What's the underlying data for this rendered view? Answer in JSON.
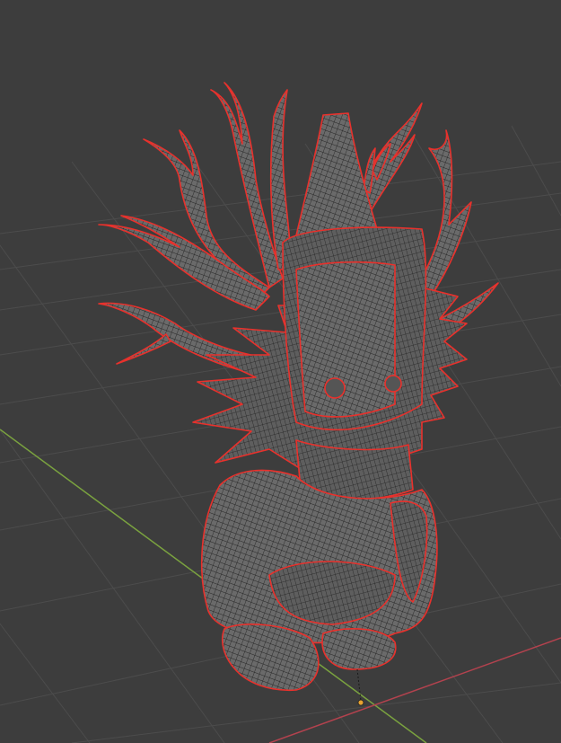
{
  "viewport": {
    "background_color": "#3d3d3d",
    "grid_color": "#4d4d4d",
    "x_axis_color": "#b3424e",
    "y_axis_color": "#7aa23f",
    "view_mode": "wireframe",
    "selection_outline_color": "#e8312c",
    "mesh_fill_color": "#666666",
    "mesh_wire_color": "#222222",
    "origin_color": "#e8a330"
  },
  "scene_object": {
    "description_icon": "tree-creature-mesh-icon",
    "selected": true
  }
}
